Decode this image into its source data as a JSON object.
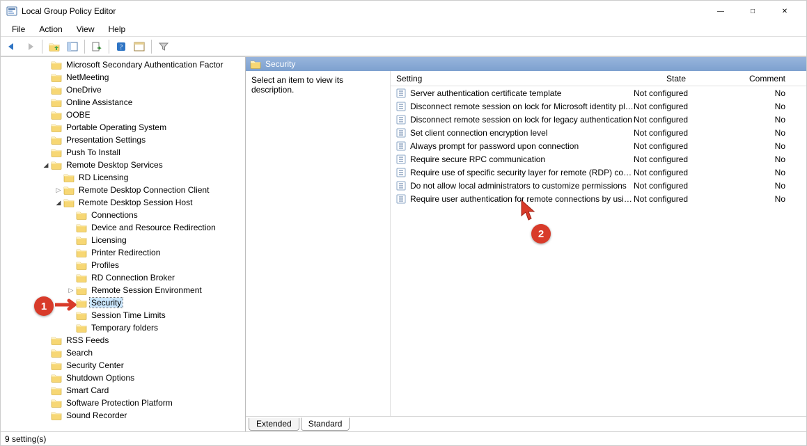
{
  "window": {
    "title": "Local Group Policy Editor"
  },
  "menus": [
    "File",
    "Action",
    "View",
    "Help"
  ],
  "statusbar": "9 setting(s)",
  "details": {
    "header": "Security",
    "description": "Select an item to view its description.",
    "cols": {
      "setting": "Setting",
      "state": "State",
      "comment": "Comment"
    },
    "settings": [
      {
        "name": "Server authentication certificate template",
        "state": "Not configured",
        "comment": "No"
      },
      {
        "name": "Disconnect remote session on lock for Microsoft identity pla...",
        "state": "Not configured",
        "comment": "No"
      },
      {
        "name": "Disconnect remote session on lock for legacy authentication",
        "state": "Not configured",
        "comment": "No"
      },
      {
        "name": "Set client connection encryption level",
        "state": "Not configured",
        "comment": "No"
      },
      {
        "name": "Always prompt for password upon connection",
        "state": "Not configured",
        "comment": "No"
      },
      {
        "name": "Require secure RPC communication",
        "state": "Not configured",
        "comment": "No"
      },
      {
        "name": "Require use of specific security layer for remote (RDP) conn...",
        "state": "Not configured",
        "comment": "No"
      },
      {
        "name": "Do not allow local administrators to customize permissions",
        "state": "Not configured",
        "comment": "No"
      },
      {
        "name": "Require user authentication for remote connections by usin...",
        "state": "Not configured",
        "comment": "No"
      }
    ],
    "tabs": {
      "extended": "Extended",
      "standard": "Standard"
    }
  },
  "tree": [
    {
      "indent": 4,
      "exp": "",
      "label": "Microsoft Secondary Authentication Factor"
    },
    {
      "indent": 4,
      "exp": "",
      "label": "NetMeeting"
    },
    {
      "indent": 4,
      "exp": "",
      "label": "OneDrive"
    },
    {
      "indent": 4,
      "exp": "",
      "label": "Online Assistance"
    },
    {
      "indent": 4,
      "exp": "",
      "label": "OOBE"
    },
    {
      "indent": 4,
      "exp": "",
      "label": "Portable Operating System"
    },
    {
      "indent": 4,
      "exp": "",
      "label": "Presentation Settings"
    },
    {
      "indent": 4,
      "exp": "",
      "label": "Push To Install"
    },
    {
      "indent": 4,
      "exp": "v",
      "label": "Remote Desktop Services"
    },
    {
      "indent": 5,
      "exp": "",
      "label": "RD Licensing"
    },
    {
      "indent": 5,
      "exp": ">",
      "label": "Remote Desktop Connection Client"
    },
    {
      "indent": 5,
      "exp": "v",
      "label": "Remote Desktop Session Host"
    },
    {
      "indent": 6,
      "exp": "",
      "label": "Connections"
    },
    {
      "indent": 6,
      "exp": "",
      "label": "Device and Resource Redirection"
    },
    {
      "indent": 6,
      "exp": "",
      "label": "Licensing"
    },
    {
      "indent": 6,
      "exp": "",
      "label": "Printer Redirection"
    },
    {
      "indent": 6,
      "exp": "",
      "label": "Profiles"
    },
    {
      "indent": 6,
      "exp": "",
      "label": "RD Connection Broker"
    },
    {
      "indent": 6,
      "exp": ">",
      "label": "Remote Session Environment"
    },
    {
      "indent": 6,
      "exp": "",
      "label": "Security",
      "selected": true
    },
    {
      "indent": 6,
      "exp": "",
      "label": "Session Time Limits"
    },
    {
      "indent": 6,
      "exp": "",
      "label": "Temporary folders"
    },
    {
      "indent": 4,
      "exp": "",
      "label": "RSS Feeds"
    },
    {
      "indent": 4,
      "exp": "",
      "label": "Search"
    },
    {
      "indent": 4,
      "exp": "",
      "label": "Security Center"
    },
    {
      "indent": 4,
      "exp": "",
      "label": "Shutdown Options"
    },
    {
      "indent": 4,
      "exp": "",
      "label": "Smart Card"
    },
    {
      "indent": 4,
      "exp": "",
      "label": "Software Protection Platform"
    },
    {
      "indent": 4,
      "exp": "",
      "label": "Sound Recorder"
    }
  ],
  "callouts": {
    "one": "1",
    "two": "2"
  }
}
